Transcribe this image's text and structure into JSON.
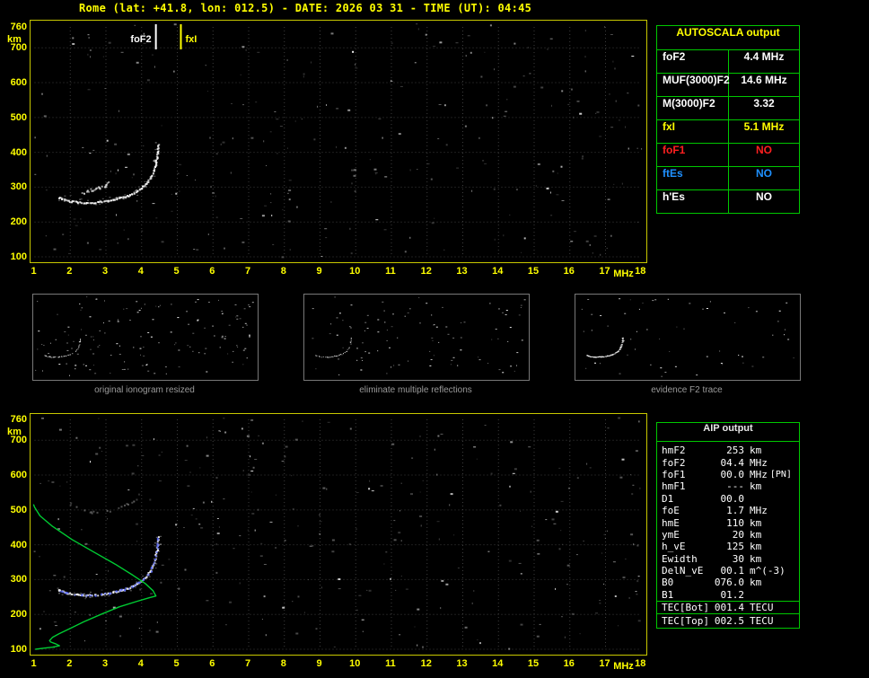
{
  "header": {
    "title": "Rome (lat: +41.8, lon: 012.5) - DATE: 2026 03 31 - TIME (UT): 04:45"
  },
  "colors": {
    "accent_yellow": "#ffff00",
    "table_border_green": "#00c800",
    "profile_green": "#00cc33",
    "restored_trace_blue": "#5566ff",
    "alert_red": "#ff2020",
    "es_blue": "#1e90ff",
    "plot_border": "#c8c800",
    "grid": "#3d3d3d"
  },
  "autoscala_table": {
    "title": "AUTOSCALA output",
    "rows": [
      {
        "label": "foF2",
        "value": "4.4 MHz",
        "color": "#ffffff"
      },
      {
        "label": "MUF(3000)F2",
        "value": "14.6 MHz",
        "color": "#ffffff"
      },
      {
        "label": "M(3000)F2",
        "value": "3.32",
        "color": "#ffffff"
      },
      {
        "label": "fxI",
        "value": "5.1 MHz",
        "color": "#ffff00"
      },
      {
        "label": "foF1",
        "value": "NO",
        "color": "#ff2020"
      },
      {
        "label": "ftEs",
        "value": "NO",
        "color": "#1e90ff"
      },
      {
        "label": "h'Es",
        "value": "NO",
        "color": "#ffffff"
      }
    ]
  },
  "aip_table": {
    "title": "AIP output",
    "rows": [
      {
        "name": "hmF2",
        "value": "253",
        "unit": "km"
      },
      {
        "name": "foF2",
        "value": "04.4",
        "unit": "MHz"
      },
      {
        "name": "foF1",
        "value": "00.0",
        "unit": "MHz",
        "note": "[PN]"
      },
      {
        "name": "hmF1",
        "value": "---",
        "unit": "km"
      },
      {
        "name": "D1",
        "value": "00.0",
        "unit": ""
      },
      {
        "name": "foE",
        "value": "1.7",
        "unit": "MHz"
      },
      {
        "name": "hmE",
        "value": "110",
        "unit": "km"
      },
      {
        "name": "ymE",
        "value": "20",
        "unit": "km"
      },
      {
        "name": "h_vE",
        "value": "125",
        "unit": "km"
      },
      {
        "name": "Ewidth",
        "value": "30",
        "unit": "km"
      },
      {
        "name": "DelN_vE",
        "value": "00.1",
        "unit": "m^(-3)"
      },
      {
        "name": "B0",
        "value": "076.0",
        "unit": "km"
      },
      {
        "name": "B1",
        "value": "01.2",
        "unit": ""
      },
      {
        "name": "TEC[Bot]",
        "value": "001.4",
        "unit": "TECU",
        "sep_above": true
      },
      {
        "name": "TEC[Top]",
        "value": "002.5",
        "unit": "TECU",
        "sep_above": true
      }
    ]
  },
  "thumbnails": [
    {
      "caption": "original ionogram resized"
    },
    {
      "caption": "eliminate multiple reflections"
    },
    {
      "caption": "evidence F2 trace"
    }
  ],
  "chart_data": [
    {
      "id": "scaled-ionogram",
      "type": "scatter",
      "title": "Scaled ionogram with AUTOSCALA markers",
      "xlabel": "MHz",
      "ylabel": "km",
      "xlim": [
        1,
        18
      ],
      "ylim": [
        100,
        760
      ],
      "x_ticks": [
        1,
        2,
        3,
        4,
        5,
        6,
        7,
        8,
        9,
        10,
        11,
        12,
        13,
        14,
        15,
        16,
        17,
        18
      ],
      "y_ticks": [
        760,
        700,
        600,
        500,
        400,
        300,
        200,
        100
      ],
      "grid": true,
      "markers": [
        {
          "label": "foF2",
          "f_mhz": 4.4,
          "color": "#ffffff",
          "side": "left"
        },
        {
          "label": "fxI",
          "f_mhz": 5.1,
          "color": "#ffff00",
          "side": "right"
        }
      ],
      "series": [
        {
          "name": "F2-trace",
          "color": "#ffffff",
          "style": "dots",
          "spread": true,
          "size": 2,
          "density": 0.97,
          "jitter": 1.6,
          "opacity": 1,
          "points": [
            [
              1.65,
              272
            ],
            [
              1.8,
              266
            ],
            [
              2.0,
              261
            ],
            [
              2.2,
              258
            ],
            [
              2.45,
              257
            ],
            [
              2.7,
              258
            ],
            [
              2.95,
              261
            ],
            [
              3.2,
              266
            ],
            [
              3.45,
              272
            ],
            [
              3.7,
              281
            ],
            [
              3.9,
              293
            ],
            [
              4.1,
              310
            ],
            [
              4.25,
              330
            ],
            [
              4.35,
              355
            ],
            [
              4.42,
              390
            ],
            [
              4.46,
              428
            ]
          ]
        },
        {
          "name": "near-trace-cluster",
          "color": "#ffffff",
          "style": "dots",
          "size": 2,
          "density": 0.85,
          "jitter": 3,
          "opacity": 0.8,
          "points": [
            [
              2.35,
              286
            ],
            [
              2.55,
              293
            ],
            [
              2.75,
              299
            ],
            [
              2.95,
              307
            ],
            [
              3.1,
              315
            ]
          ]
        }
      ],
      "noise": {
        "count": 270,
        "seed": 11
      }
    },
    {
      "id": "profile-ionogram",
      "type": "scatter",
      "title": "Ionogram with restored trace and electron density profile",
      "xlabel": "MHz",
      "ylabel": "km",
      "xlim": [
        1,
        18
      ],
      "ylim": [
        100,
        760
      ],
      "x_ticks": [
        1,
        2,
        3,
        4,
        5,
        6,
        7,
        8,
        9,
        10,
        11,
        12,
        13,
        14,
        15,
        16,
        17,
        18
      ],
      "y_ticks": [
        760,
        700,
        600,
        500,
        400,
        300,
        200,
        100
      ],
      "grid": true,
      "markers": [],
      "series": [
        {
          "name": "F2-trace",
          "color": "#ffffff",
          "style": "dots",
          "spread": true,
          "size": 2,
          "density": 0.95,
          "jitter": 1.6,
          "opacity": 1,
          "points": [
            [
              1.65,
              272
            ],
            [
              1.8,
              266
            ],
            [
              2.0,
              261
            ],
            [
              2.2,
              258
            ],
            [
              2.45,
              257
            ],
            [
              2.7,
              258
            ],
            [
              2.95,
              261
            ],
            [
              3.2,
              266
            ],
            [
              3.45,
              272
            ],
            [
              3.7,
              281
            ],
            [
              3.9,
              293
            ],
            [
              4.1,
              310
            ],
            [
              4.25,
              330
            ],
            [
              4.35,
              355
            ],
            [
              4.42,
              390
            ],
            [
              4.46,
              428
            ]
          ]
        },
        {
          "name": "second-hop-echo",
          "color": "#aaaaaa",
          "style": "dots",
          "size": 2,
          "density": 0.4,
          "jitter": 3,
          "opacity": 0.55,
          "points": [
            [
              1.95,
              520
            ],
            [
              2.2,
              505
            ],
            [
              2.5,
              496
            ],
            [
              2.8,
              494
            ],
            [
              3.1,
              498
            ],
            [
              3.4,
              508
            ],
            [
              3.7,
              524
            ],
            [
              3.95,
              545
            ]
          ]
        },
        {
          "name": "restored-F2-trace",
          "color": "#5566ff",
          "style": "dots",
          "size": 2,
          "density": 0.55,
          "jitter": 2.2,
          "opacity": 0.9,
          "points": [
            [
              1.65,
              272
            ],
            [
              1.8,
              266
            ],
            [
              2.0,
              261
            ],
            [
              2.2,
              258
            ],
            [
              2.45,
              257
            ],
            [
              2.7,
              258
            ],
            [
              2.95,
              261
            ],
            [
              3.2,
              266
            ],
            [
              3.45,
              272
            ],
            [
              3.7,
              281
            ],
            [
              3.9,
              293
            ],
            [
              4.1,
              310
            ],
            [
              4.25,
              330
            ],
            [
              4.35,
              355
            ],
            [
              4.42,
              390
            ],
            [
              4.46,
              428
            ]
          ]
        },
        {
          "name": "electron-density-profile",
          "color": "#00cc33",
          "style": "line",
          "points": [
            [
              1.02,
              100
            ],
            [
              1.25,
              103
            ],
            [
              1.5,
              106
            ],
            [
              1.7,
              110
            ],
            [
              1.58,
              116
            ],
            [
              1.45,
              121
            ],
            [
              1.42,
              125
            ],
            [
              1.5,
              134
            ],
            [
              1.68,
              144
            ],
            [
              1.98,
              159
            ],
            [
              2.38,
              179
            ],
            [
              2.88,
              201
            ],
            [
              3.38,
              222
            ],
            [
              3.88,
              238
            ],
            [
              4.22,
              248
            ],
            [
              4.4,
              253
            ],
            [
              4.32,
              268
            ],
            [
              4.1,
              289
            ],
            [
              3.75,
              313
            ],
            [
              3.28,
              343
            ],
            [
              2.68,
              378
            ],
            [
              2.05,
              415
            ],
            [
              1.5,
              453
            ],
            [
              1.15,
              483
            ],
            [
              1.0,
              508
            ],
            [
              0.97,
              516
            ]
          ]
        }
      ],
      "noise": {
        "count": 290,
        "seed": 29
      }
    }
  ]
}
